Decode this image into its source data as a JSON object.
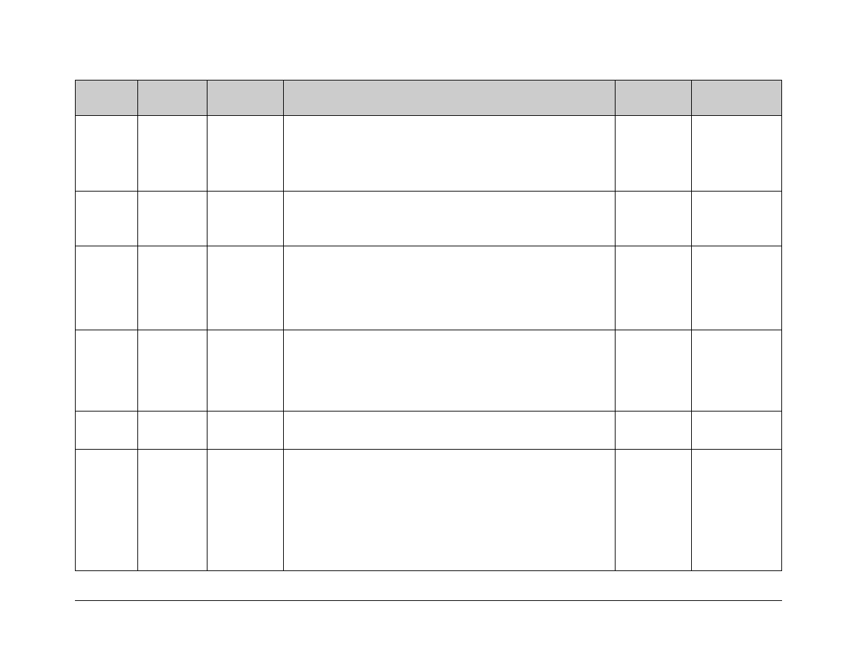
{
  "table": {
    "headers": [
      "",
      "",
      "",
      "",
      "",
      ""
    ],
    "rows": [
      [
        "",
        "",
        "",
        "",
        "",
        ""
      ],
      [
        "",
        "",
        "",
        "",
        "",
        ""
      ],
      [
        "",
        "",
        "",
        "",
        "",
        ""
      ],
      [
        "",
        "",
        "",
        "",
        "",
        ""
      ],
      [
        "",
        "",
        "",
        "",
        "",
        ""
      ],
      [
        "",
        "",
        "",
        "",
        "",
        ""
      ]
    ]
  }
}
